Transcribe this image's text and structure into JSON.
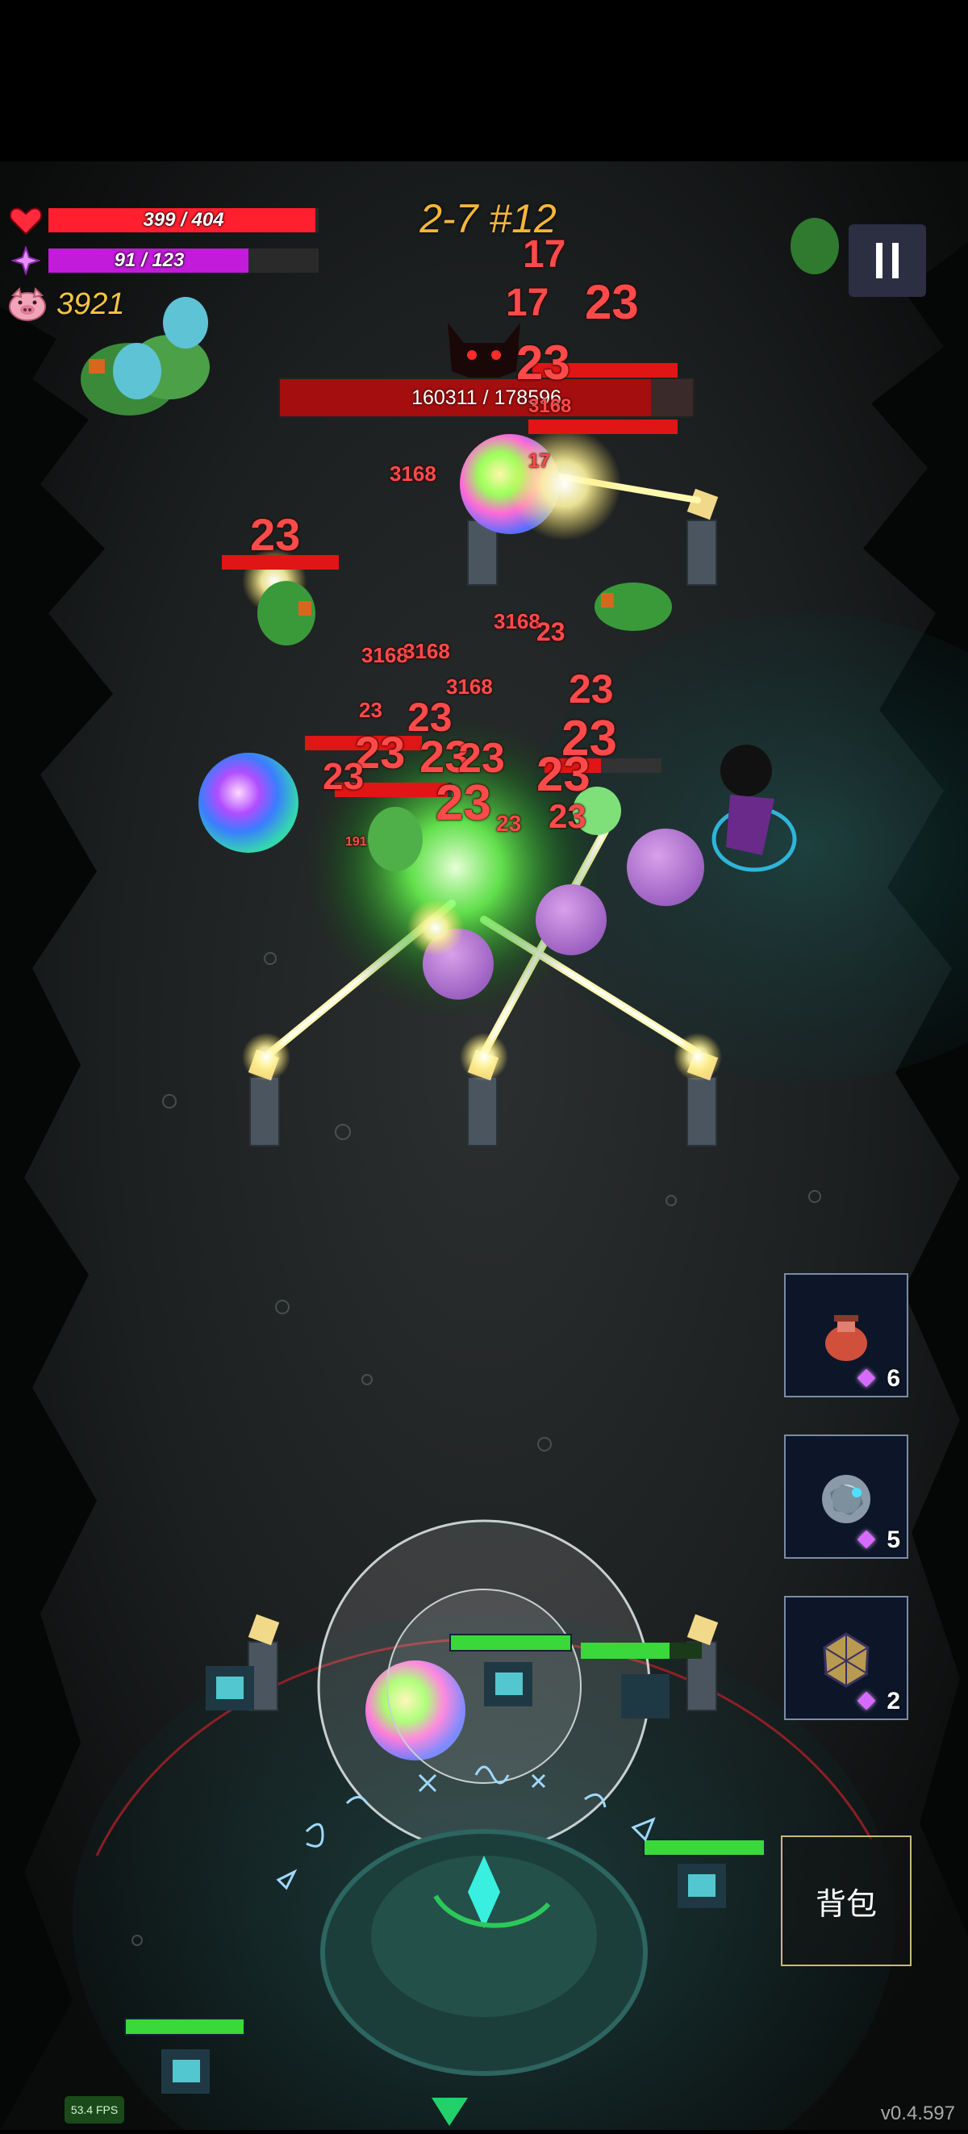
{
  "hud": {
    "health": {
      "current": 399,
      "max": 404,
      "text": "399 / 404",
      "icon": "heart-icon",
      "color": "#ff1f2e"
    },
    "mana": {
      "current": 91,
      "max": 123,
      "text": "91 / 123",
      "icon": "diamond-gem-icon",
      "color": "#c21bd9"
    },
    "coins": {
      "value": "3921",
      "icon": "pig-icon"
    },
    "stage": "2-7 #12",
    "pause_icon": "pause-icon"
  },
  "boss": {
    "icon": "demon-face-icon",
    "current": 160311,
    "max": 178596,
    "text": "160311 / 178596"
  },
  "damage_numbers": [
    "17",
    "17",
    "23",
    "23",
    "3168",
    "3168",
    "17",
    "3168",
    "3168",
    "3168",
    "23",
    "23",
    "23",
    "3168",
    "23",
    "23",
    "23",
    "23",
    "23",
    "23",
    "23",
    "23",
    "23",
    "23",
    "23",
    "191"
  ],
  "items": [
    {
      "name": "red-potion-jar-icon",
      "count": "6"
    },
    {
      "name": "grey-stone-orb-icon",
      "count": "5"
    },
    {
      "name": "gold-polyhedron-icon",
      "count": "2"
    }
  ],
  "backpack_label": "背包",
  "fps": "53.4 FPS",
  "version": "v0.4.597"
}
